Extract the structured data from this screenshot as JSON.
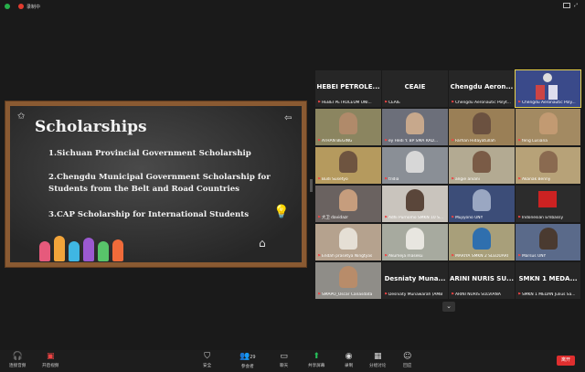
{
  "topbar": {
    "recording_label": "录制中"
  },
  "slide": {
    "title": "Scholarships",
    "items": [
      "1.Sichuan Provincial Government Scholarship",
      "2.Chengdu Municipal Government Scholarship for Students from the Belt and Road Countries",
      "3.CAP Scholarship for International Students"
    ]
  },
  "gallery": {
    "row1": [
      {
        "title": "HEBEI PETROLE...",
        "caption": "HEBEI PETROLEUM UNI..."
      },
      {
        "title": "CEAIE",
        "caption": "CEAIE"
      },
      {
        "title": "Chengdu Aeron...",
        "caption": "Chengdu Aeronautic Polyt..."
      },
      {
        "title": "",
        "caption": "Chengdu Aeronautic Poly..."
      }
    ],
    "row2": [
      "ATHAN BEGING",
      "ey Hedi Y. BP SMA RAD...",
      "Farhan Hidayatullah",
      "feng Lusiana"
    ],
    "row3": [
      "Budi Susetyo",
      "tridia",
      "angie aniani",
      "Akanak Benny"
    ],
    "row4": [
      "大卫 davidazr",
      "Adhi Purnomo SMKN 10 S...",
      "Mujiyono UNY",
      "Indonesian Embassy"
    ],
    "row5": [
      "Endah prasetya Ningtyas",
      "Akumeja maseku",
      "MARIYA SMKN 2 SLEDUARI",
      "Marsus UNY"
    ],
    "row6": [
      {
        "title": "",
        "caption": "SMAPO_Oscar Canasdata"
      },
      {
        "title": "Desniaty Muna...",
        "caption": "Desniaty Munawarah (AMB"
      },
      {
        "title": "ARINI NURIS SU...",
        "caption": "ARINI NURIS SULVIANA"
      },
      {
        "title": "SMKN 1 MEDA...",
        "caption": "SMKN 1 MEDAN Julius Sa..."
      }
    ]
  },
  "toolbar": {
    "audio": "连接音频",
    "video": "开启视频",
    "security": "安全",
    "participants": "参会者",
    "participants_count": "29",
    "chat": "聊天",
    "share": "共享屏幕",
    "record": "录制",
    "breakout": "分组讨论",
    "reactions": "回应",
    "leave": "离开"
  },
  "colors": {
    "share_green": "#26c05a",
    "leave_red": "#e02f2f",
    "board_frame": "#8a5a32"
  }
}
